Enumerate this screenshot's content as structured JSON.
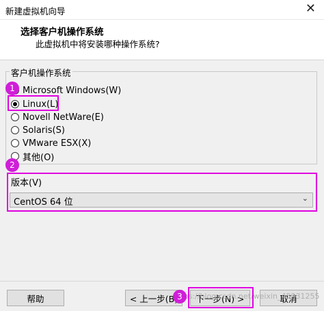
{
  "window": {
    "title": "新建虚拟机向导",
    "close_glyph": "✕"
  },
  "header": {
    "title": "选择客户机操作系统",
    "subtitle": "此虚拟机中将安装哪种操作系统?"
  },
  "os_group": {
    "label": "客户机操作系统",
    "options": [
      {
        "label": "Microsoft Windows(W)",
        "checked": false
      },
      {
        "label": "Linux(L)",
        "checked": true
      },
      {
        "label": "Novell NetWare(E)",
        "checked": false
      },
      {
        "label": "Solaris(S)",
        "checked": false
      },
      {
        "label": "VMware ESX(X)",
        "checked": false
      },
      {
        "label": "其他(O)",
        "checked": false
      }
    ]
  },
  "version": {
    "label": "版本(V)",
    "selected": "CentOS 64 位",
    "chevron": "⌄"
  },
  "buttons": {
    "help": "帮助",
    "back": "< 上一步(B)",
    "next": "下一步(N) >",
    "cancel": "取消"
  },
  "annotations": {
    "badge1": "1",
    "badge2": "2",
    "badge3": "3",
    "highlight_color": "#e000e0"
  },
  "watermark": "https://blog.csdn.net/weixin_45931255"
}
